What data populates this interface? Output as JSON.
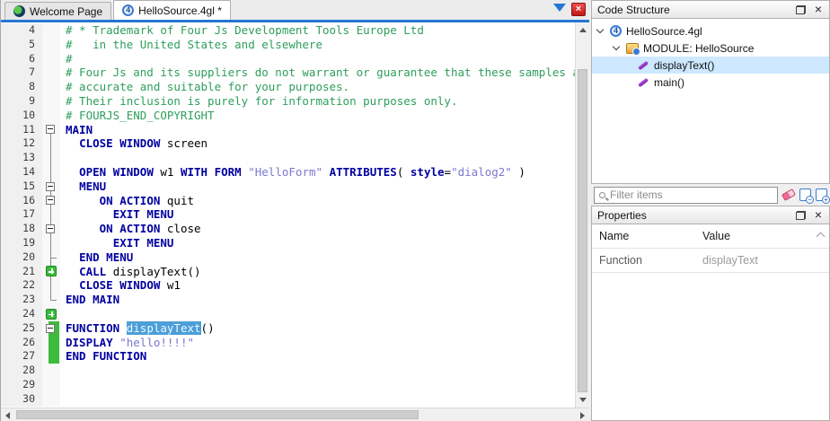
{
  "colors": {
    "keyword": "#0000a0",
    "comment": "#2e9e5b",
    "string": "#7878d2",
    "accent_blue": "#2577d4",
    "vcs_green": "#3cbb3c",
    "highlight_bg": "#4c9fd8",
    "tree_selection": "#cde8ff"
  },
  "tab_bar": {
    "tabs": [
      {
        "label": "Welcome Page",
        "icon": "welcome-icon",
        "active": false
      },
      {
        "label": "HelloSource.4gl *",
        "icon": "file-4gl-icon",
        "active": true
      }
    ],
    "icons": [
      "tab-list-dropdown",
      "close-tab"
    ]
  },
  "editor": {
    "lines": [
      {
        "n": 4,
        "f": "",
        "v": "",
        "s": [
          [
            "# * Trademark of Four Js Development Tools Europe Ltd",
            "c"
          ]
        ]
      },
      {
        "n": 5,
        "f": "",
        "v": "",
        "s": [
          [
            "#   in the United States and elsewhere",
            "c"
          ]
        ]
      },
      {
        "n": 6,
        "f": "",
        "v": "",
        "s": [
          [
            "#",
            "c"
          ]
        ]
      },
      {
        "n": 7,
        "f": "",
        "v": "",
        "s": [
          [
            "# Four Js and its suppliers do not warrant or guarantee that these samples a",
            "c"
          ]
        ]
      },
      {
        "n": 8,
        "f": "",
        "v": "",
        "s": [
          [
            "# accurate and suitable for your purposes.",
            "c"
          ]
        ]
      },
      {
        "n": 9,
        "f": "",
        "v": "",
        "s": [
          [
            "# Their inclusion is purely for information purposes only.",
            "c"
          ]
        ]
      },
      {
        "n": 10,
        "f": "",
        "v": "",
        "s": [
          [
            "# FOURJS_END_COPYRIGHT",
            "c"
          ]
        ]
      },
      {
        "n": 11,
        "f": "box,below",
        "v": "",
        "s": [
          [
            "MAIN",
            "k"
          ]
        ]
      },
      {
        "n": 12,
        "f": "full",
        "v": "",
        "s": [
          [
            "  ",
            "p"
          ],
          [
            "CLOSE WINDOW",
            "k"
          ],
          [
            " screen",
            "p"
          ]
        ]
      },
      {
        "n": 13,
        "f": "full",
        "v": "",
        "s": []
      },
      {
        "n": 14,
        "f": "full",
        "v": "",
        "s": [
          [
            "  ",
            "p"
          ],
          [
            "OPEN WINDOW",
            "k"
          ],
          [
            " w1 ",
            "p"
          ],
          [
            "WITH FORM",
            "k"
          ],
          [
            " ",
            "p"
          ],
          [
            "\"HelloForm\"",
            "s"
          ],
          [
            " ",
            "p"
          ],
          [
            "ATTRIBUTES",
            "k"
          ],
          [
            "( ",
            "p"
          ],
          [
            "style",
            "k"
          ],
          [
            "=",
            "p"
          ],
          [
            "\"dialog2\"",
            "s"
          ],
          [
            " )",
            "p"
          ]
        ]
      },
      {
        "n": 15,
        "f": "box,full",
        "v": "",
        "s": [
          [
            "  ",
            "p"
          ],
          [
            "MENU",
            "k"
          ]
        ]
      },
      {
        "n": 16,
        "f": "box,full",
        "v": "",
        "s": [
          [
            "     ",
            "p"
          ],
          [
            "ON ACTION",
            "k"
          ],
          [
            " quit",
            "p"
          ]
        ]
      },
      {
        "n": 17,
        "f": "full",
        "v": "",
        "s": [
          [
            "       ",
            "p"
          ],
          [
            "EXIT MENU",
            "k"
          ]
        ]
      },
      {
        "n": 18,
        "f": "box,full",
        "v": "",
        "s": [
          [
            "     ",
            "p"
          ],
          [
            "ON ACTION",
            "k"
          ],
          [
            " close",
            "p"
          ]
        ]
      },
      {
        "n": 19,
        "f": "full",
        "v": "",
        "s": [
          [
            "       ",
            "p"
          ],
          [
            "EXIT MENU",
            "k"
          ]
        ]
      },
      {
        "n": 20,
        "f": "branch",
        "v": "",
        "s": [
          [
            "  ",
            "p"
          ],
          [
            "END MENU",
            "k"
          ]
        ]
      },
      {
        "n": 21,
        "f": "full",
        "v": "plus",
        "s": [
          [
            "  ",
            "p"
          ],
          [
            "CALL",
            "k"
          ],
          [
            " displayText()",
            "p"
          ]
        ]
      },
      {
        "n": 22,
        "f": "full",
        "v": "",
        "s": [
          [
            "  ",
            "p"
          ],
          [
            "CLOSE WINDOW",
            "k"
          ],
          [
            " w1",
            "p"
          ]
        ]
      },
      {
        "n": 23,
        "f": "end",
        "v": "",
        "s": [
          [
            "END MAIN",
            "k"
          ]
        ]
      },
      {
        "n": 24,
        "f": "",
        "v": "plus",
        "s": []
      },
      {
        "n": 25,
        "f": "box,below",
        "v": "bar",
        "s": [
          [
            "FUNCTION",
            "k"
          ],
          [
            " ",
            "p"
          ],
          [
            "displayText",
            "h"
          ],
          [
            "()",
            "p"
          ]
        ]
      },
      {
        "n": 26,
        "f": "full",
        "v": "bar",
        "s": [
          [
            "DISPLAY",
            "k"
          ],
          [
            " ",
            "p"
          ],
          [
            "\"hello!!!!\"",
            "s"
          ]
        ]
      },
      {
        "n": 27,
        "f": "end",
        "v": "bar",
        "s": [
          [
            "END FUNCTION",
            "k"
          ]
        ]
      },
      {
        "n": 28,
        "f": "",
        "v": "",
        "s": []
      },
      {
        "n": 29,
        "f": "",
        "v": "",
        "s": []
      },
      {
        "n": 30,
        "f": "",
        "v": "",
        "s": []
      }
    ]
  },
  "code_structure": {
    "title": "Code Structure",
    "items": [
      {
        "label": "HelloSource.4gl",
        "icon": "file-4gl",
        "level": 0,
        "expander": true,
        "selected": false
      },
      {
        "label": "MODULE: HelloSource",
        "icon": "module",
        "level": 1,
        "expander": true,
        "selected": false
      },
      {
        "label": "displayText()",
        "icon": "function",
        "level": 2,
        "expander": false,
        "selected": true
      },
      {
        "label": "main()",
        "icon": "function",
        "level": 2,
        "expander": false,
        "selected": false
      }
    ]
  },
  "filter": {
    "placeholder": "Filter items",
    "icons": [
      "clear-filter",
      "collapse-all",
      "expand-all"
    ]
  },
  "properties": {
    "title": "Properties",
    "columns": [
      "Name",
      "Value"
    ],
    "rows": [
      {
        "name": "Function",
        "value": "displayText"
      }
    ]
  }
}
